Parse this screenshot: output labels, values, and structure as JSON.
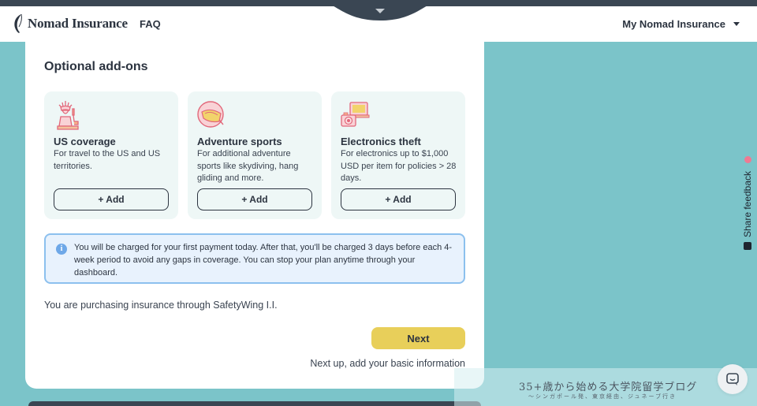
{
  "header": {
    "brand": "Nomad Insurance",
    "faq_label": "FAQ",
    "account_label": "My Nomad Insurance"
  },
  "addons": {
    "title": "Optional add-ons",
    "items": [
      {
        "name": "US coverage",
        "description": "For travel to the US and US territories.",
        "button": "+ Add",
        "icon": "statue-of-liberty-icon"
      },
      {
        "name": "Adventure sports",
        "description": "For additional adventure sports like skydiving, hang gliding and more.",
        "button": "+ Add",
        "icon": "helmet-icon"
      },
      {
        "name": "Electronics theft",
        "description": "For electronics up to $1,000 USD per item for policies > 28 days.",
        "button": "+ Add",
        "icon": "camera-laptop-icon"
      }
    ]
  },
  "info": {
    "text": "You will be charged for your first payment today. After that, you'll be charged 3 days before each 4-week period to avoid any gaps in coverage. You can stop your plan anytime through your dashboard."
  },
  "purchasing_text": "You are purchasing insurance through SafetyWing I.I.",
  "next_button": "Next",
  "next_up_text": "Next up, add your basic information",
  "feedback_label": "Share feedback",
  "watermark": {
    "title": "35+歳から始める大学院留学ブログ",
    "subtitle": "～シンガポール発、東京経由、ジュネーブ行き"
  },
  "colors": {
    "teal_background": "#7bc4c9",
    "card_tint": "#eef7f6",
    "next_button": "#e8cf5a",
    "info_border": "#8cc0ee",
    "dark_text": "#2c3440"
  }
}
